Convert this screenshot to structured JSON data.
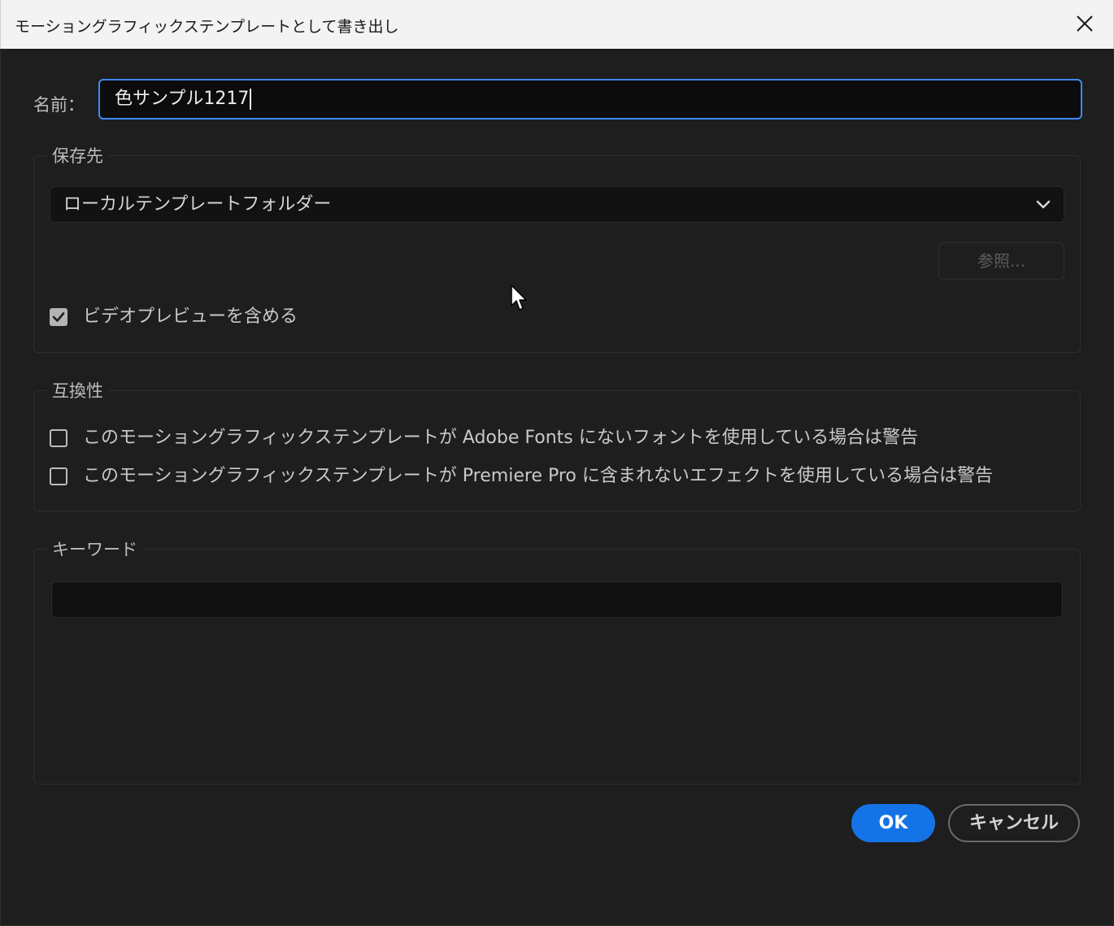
{
  "window": {
    "title": "モーショングラフィックステンプレートとして書き出し"
  },
  "name_field": {
    "label": "名前：",
    "value": "色サンプル1217"
  },
  "destination": {
    "legend": "保存先",
    "selected": "ローカルテンプレートフォルダー",
    "browse_label": "参照...",
    "include_preview": {
      "label": "ビデオプレビューを含める",
      "checked": true
    }
  },
  "compatibility": {
    "legend": "互換性",
    "options": [
      {
        "label": "このモーショングラフィックステンプレートが Adobe Fonts にないフォントを使用している場合は警告",
        "checked": false
      },
      {
        "label": "このモーショングラフィックステンプレートが Premiere Pro に含まれないエフェクトを使用している場合は警告",
        "checked": false
      }
    ]
  },
  "keywords": {
    "legend": "キーワード",
    "value": ""
  },
  "buttons": {
    "ok": "OK",
    "cancel": "キャンセル"
  },
  "colors": {
    "accent": "#1473e6",
    "focus_ring": "#3d8af7",
    "background": "#1e1e1e"
  }
}
